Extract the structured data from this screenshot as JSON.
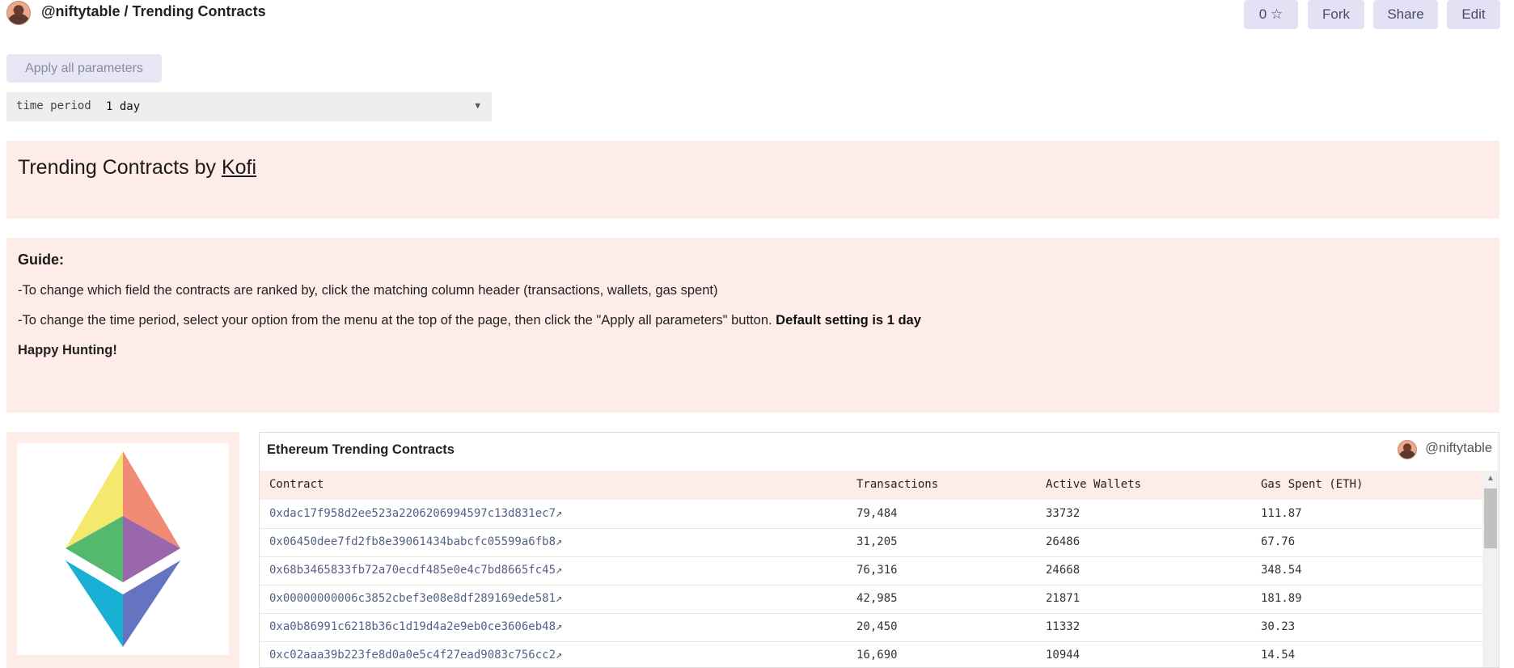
{
  "header": {
    "title": "@niftytable / Trending Contracts",
    "star_count": "0",
    "fork_label": "Fork",
    "share_label": "Share",
    "edit_label": "Edit"
  },
  "params": {
    "apply_label": "Apply all parameters",
    "time_period_label": "time period",
    "time_period_value": "1 day"
  },
  "title_panel": {
    "heading": "Trending Contracts by ",
    "author_link": "Kofi"
  },
  "guide": {
    "heading": "Guide:",
    "line1": "-To change which field the contracts are ranked by, click the matching column header (transactions, wallets, gas spent)",
    "line2": "-To change the time period, select your option from the menu at the top of the page, then click the \"Apply all parameters\" button. ",
    "line2_bold": "Default setting is 1 day",
    "line3": "Happy Hunting!"
  },
  "table": {
    "title": "Ethereum Trending Contracts",
    "owner": "@niftytable",
    "columns": [
      "Contract",
      "Transactions",
      "Active Wallets",
      "Gas Spent (ETH)"
    ],
    "rows": [
      [
        "0xdac17f958d2ee523a2206206994597c13d831ec7↗",
        "79,484",
        "33732",
        "111.87"
      ],
      [
        "0x06450dee7fd2fb8e39061434babcfc05599a6fb8↗",
        "31,205",
        "26486",
        "67.76"
      ],
      [
        "0x68b3465833fb72a70ecdf485e0e4c7bd8665fc45↗",
        "76,316",
        "24668",
        "348.54"
      ],
      [
        "0x00000000006c3852cbef3e08e8df289169ede581↗",
        "42,985",
        "21871",
        "181.89"
      ],
      [
        "0xa0b86991c6218b36c1d19d4a2e9eb0ce3606eb48↗",
        "20,450",
        "11332",
        "30.23"
      ],
      [
        "0xc02aaa39b223fe8d0a0e5c4f27ead9083c756cc2↗",
        "16,690",
        "10944",
        "14.54"
      ]
    ]
  },
  "colors": {
    "panel_bg": "#fdece8",
    "button_bg": "#e2e2f4",
    "link": "#556088"
  }
}
